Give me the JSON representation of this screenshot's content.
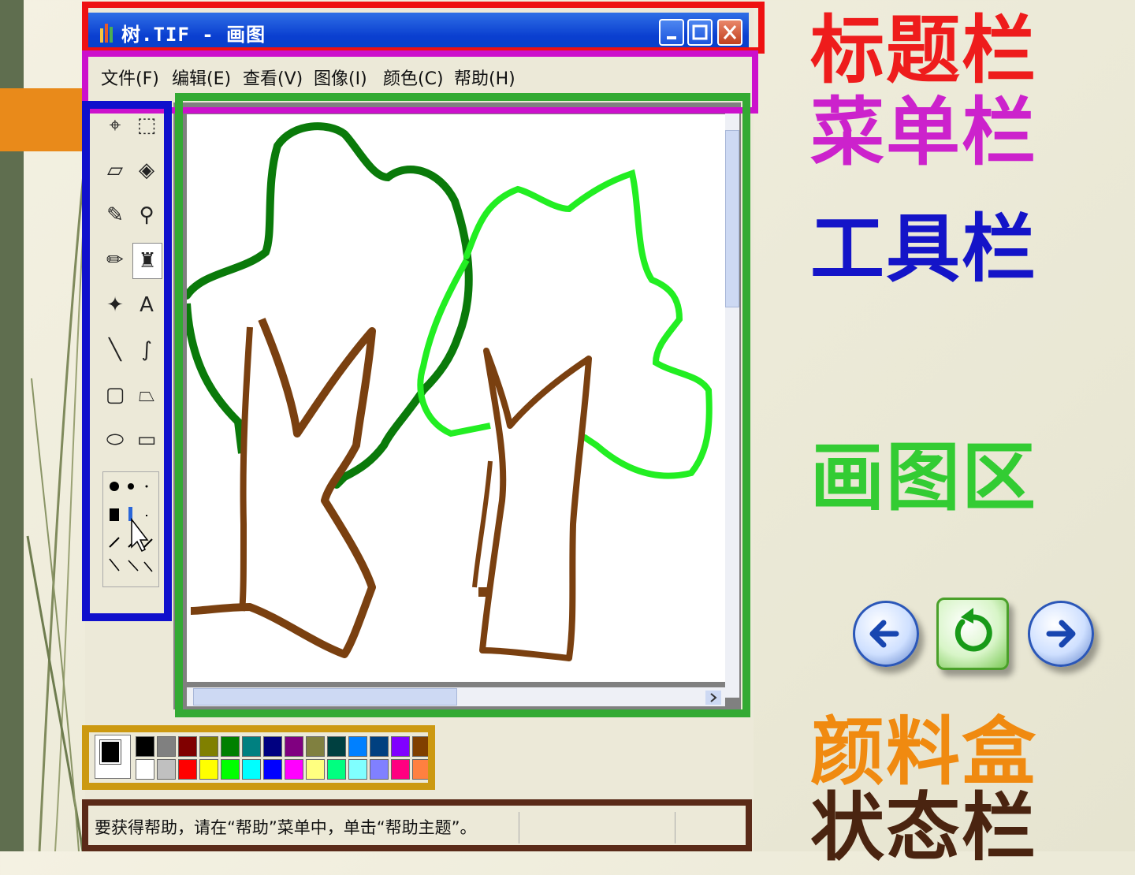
{
  "window": {
    "title": "树.TIF - 画图",
    "menus": [
      "文件(F)",
      "编辑(E)",
      "查看(V)",
      "图像(I)",
      "颜色(C)",
      "帮助(H)"
    ],
    "status_text": "要获得帮助，请在“帮助”菜单中，单击“帮助主题”。"
  },
  "annotations": {
    "title_bar": "标题栏",
    "menu_bar": "菜单栏",
    "toolbar": "工具栏",
    "canvas": "画图区",
    "palette": "颜料盒",
    "status_bar": "状态栏"
  },
  "colors": {
    "title_highlight": "#ee1111",
    "menu_highlight": "#cc11cc",
    "toolbar_highlight": "#1010cc",
    "canvas_highlight": "#33aa33",
    "palette_highlight": "#cc9911",
    "status_highlight": "#5a2a18",
    "label_title": "#ee1c1c",
    "label_menu": "#cc22cc",
    "label_toolbar": "#1414c8",
    "label_canvas": "#33cc33",
    "label_palette": "#f08a10",
    "label_status": "#4a2410"
  },
  "palette": {
    "top": [
      "#000000",
      "#808080",
      "#800000",
      "#808000",
      "#008000",
      "#008080",
      "#000080",
      "#800080",
      "#808040",
      "#004040",
      "#0080ff",
      "#004080",
      "#8000ff",
      "#804000"
    ],
    "bottom": [
      "#ffffff",
      "#c0c0c0",
      "#ff0000",
      "#ffff00",
      "#00ff00",
      "#00ffff",
      "#0000ff",
      "#ff00ff",
      "#ffff80",
      "#00ff80",
      "#80ffff",
      "#8080ff",
      "#ff0080",
      "#ff8040"
    ]
  },
  "tools": [
    "free-select-icon",
    "rect-select-icon",
    "eraser-icon",
    "fill-icon",
    "color-picker-icon",
    "magnifier-icon",
    "pencil-icon",
    "brush-icon",
    "airbrush-icon",
    "text-icon",
    "line-icon",
    "curve-icon",
    "rectangle-icon",
    "polygon-icon",
    "ellipse-icon",
    "rounded-rect-icon"
  ],
  "nav_icons": [
    "arrow-left-icon",
    "return-icon",
    "arrow-right-icon"
  ]
}
